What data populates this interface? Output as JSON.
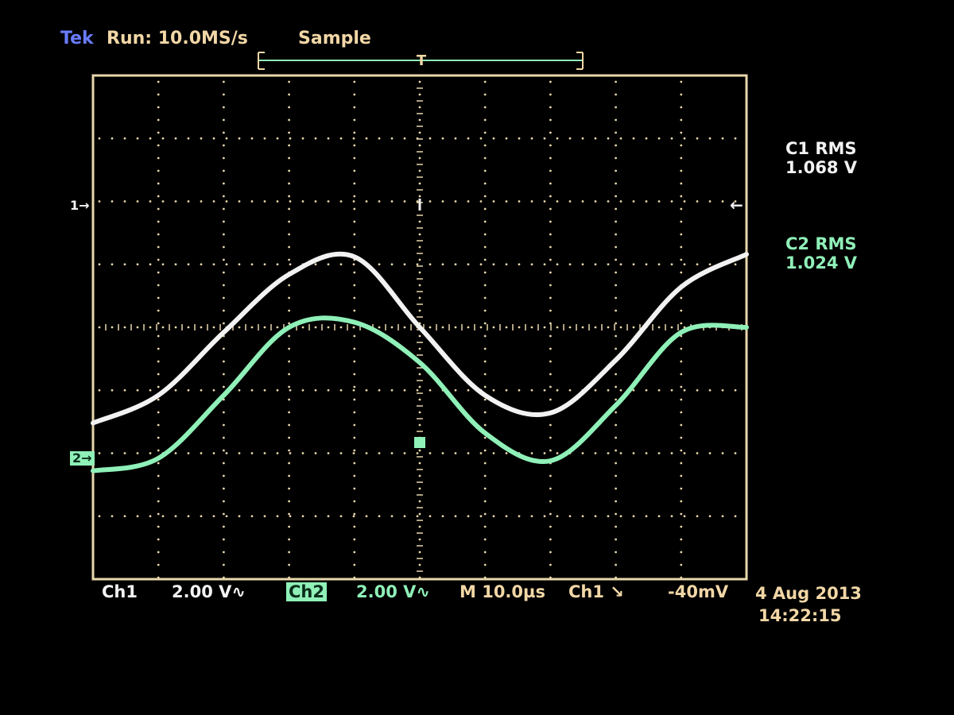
{
  "header": {
    "brand": "Tek",
    "run_status": "Run: 10.0MS/s",
    "acquisition_mode": "Sample"
  },
  "measurements": [
    {
      "label": "C1 RMS",
      "value": "1.068 V",
      "color": "#f2f2f2"
    },
    {
      "label": "C2 RMS",
      "value": "1.024 V",
      "color": "#8ff0b8"
    }
  ],
  "footer": {
    "ch1": "Ch1",
    "ch1_scale": "2.00 V∿",
    "ch2": "Ch2",
    "ch2_scale": "2.00 V∿",
    "timebase": "M 10.0µs",
    "trigger_source": "Ch1 ↘",
    "trigger_level": "-40mV",
    "date": "4 Aug 2013",
    "time": "14:22:15"
  },
  "channel_markers": {
    "ch1": "1→",
    "ch2": "2→",
    "right_marker": "←"
  },
  "colors": {
    "background": "#000000",
    "graticule": "#e8d7ac",
    "ch1_trace": "#f2f2f2",
    "ch2_trace": "#8ff0b8",
    "status_text": "#f2d7a6"
  },
  "chart_data": {
    "type": "line",
    "title": "",
    "xlabel": "",
    "ylabel": "",
    "x": [
      -50,
      -40,
      -30,
      -20,
      -10,
      0,
      10,
      20,
      30,
      40,
      50
    ],
    "xlim": [
      -50,
      50
    ],
    "ylim": [
      -10,
      10
    ],
    "grid": true,
    "series": [
      {
        "name": "C1",
        "values": [
          -3.8,
          -2.7,
          -0.2,
          2.1,
          2.8,
          0.0,
          -2.7,
          -3.4,
          -1.3,
          1.6,
          2.9
        ]
      },
      {
        "name": "C2",
        "values": [
          -5.7,
          -5.2,
          -2.7,
          0.0,
          0.2,
          -1.4,
          -4.2,
          -5.3,
          -3.1,
          -0.2,
          0.0
        ]
      }
    ]
  }
}
